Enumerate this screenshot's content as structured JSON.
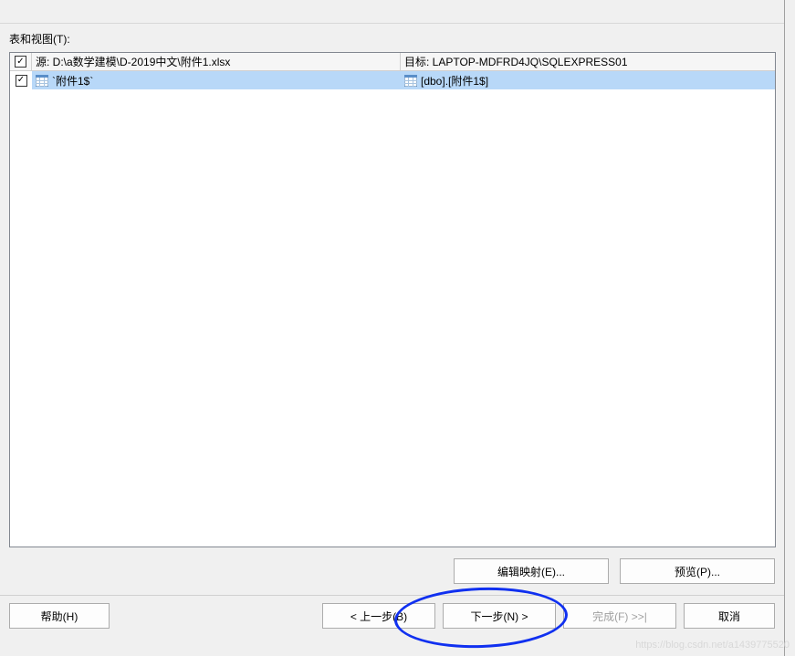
{
  "section_label": "表和视图(T):",
  "table_header": {
    "source": "源: D:\\a数学建模\\D-2019中文\\附件1.xlsx",
    "target": "目标: LAPTOP-MDFRD4JQ\\SQLEXPRESS01"
  },
  "rows": [
    {
      "checked": true,
      "source": "`附件1$`",
      "target": "[dbo].[附件1$]"
    }
  ],
  "buttons": {
    "edit_mapping": "编辑映射(E)...",
    "preview": "预览(P)...",
    "help": "帮助(H)",
    "back": "< 上一步(B)",
    "next": "下一步(N) >",
    "finish": "完成(F) >>|",
    "cancel": "取消"
  },
  "watermark": "https://blog.csdn.net/a1439775520"
}
